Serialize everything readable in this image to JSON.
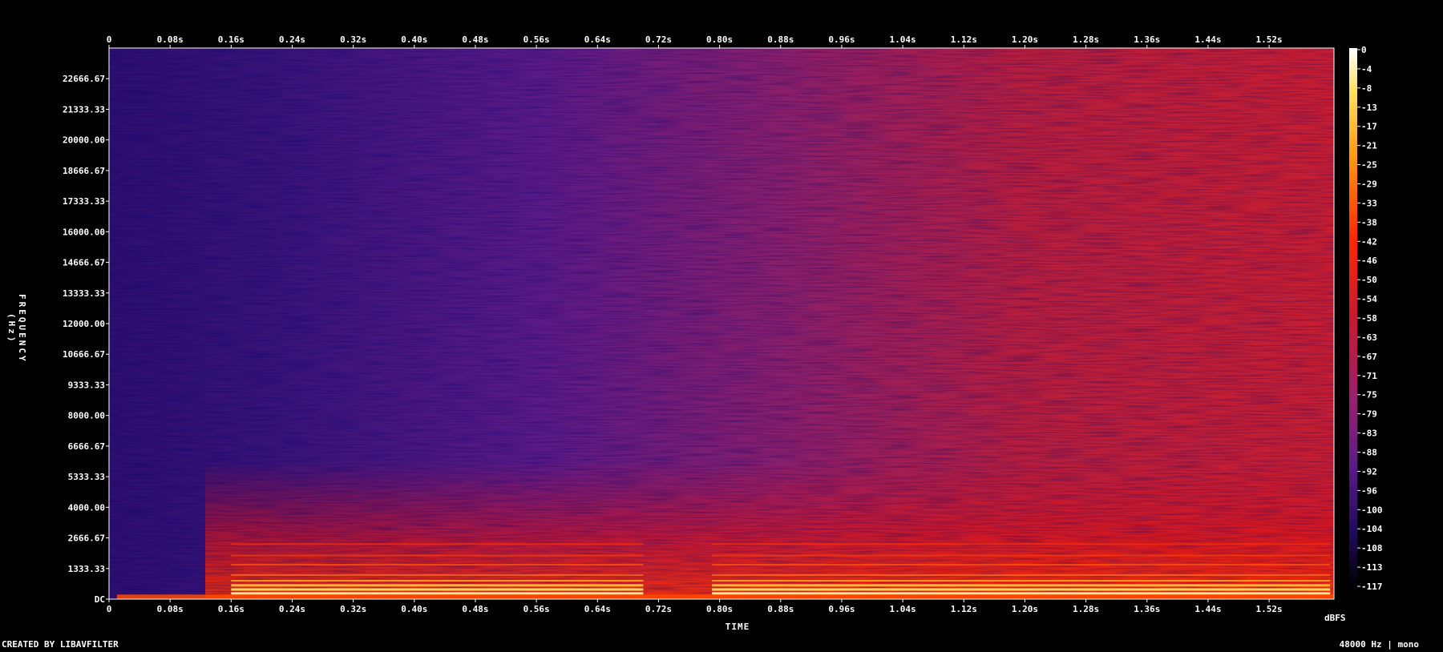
{
  "chart_data": {
    "type": "heatmap",
    "title": "",
    "xlabel": "TIME",
    "ylabel": "FREQUENCY (Hz)",
    "x_tick_labels": [
      "0",
      "0.08s",
      "0.16s",
      "0.24s",
      "0.32s",
      "0.40s",
      "0.48s",
      "0.56s",
      "0.64s",
      "0.72s",
      "0.80s",
      "0.88s",
      "0.96s",
      "1.04s",
      "1.12s",
      "1.20s",
      "1.28s",
      "1.36s",
      "1.44s",
      "1.52s"
    ],
    "x_ticks": [
      0,
      0.08,
      0.16,
      0.24,
      0.32,
      0.4,
      0.48,
      0.56,
      0.64,
      0.72,
      0.8,
      0.88,
      0.96,
      1.04,
      1.12,
      1.2,
      1.28,
      1.36,
      1.44,
      1.52
    ],
    "xlim": [
      0,
      1.605
    ],
    "y_tick_labels": [
      "DC",
      "1333.33",
      "2666.67",
      "4000.00",
      "5333.33",
      "6666.67",
      "8000.00",
      "9333.33",
      "10666.67",
      "12000.00",
      "13333.33",
      "14666.67",
      "16000.00",
      "17333.33",
      "18666.67",
      "20000.00",
      "21333.33",
      "22666.67"
    ],
    "y_ticks": [
      0,
      1333.33,
      2666.67,
      4000,
      5333.33,
      6666.67,
      8000,
      9333.33,
      10666.67,
      12000,
      13333.33,
      14666.67,
      16000,
      17333.33,
      18666.67,
      20000,
      21333.33,
      22666.67
    ],
    "ylim": [
      0,
      24000
    ],
    "colorbar": {
      "unit": "dBFS",
      "tick_labels": [
        "0",
        "-4",
        "-8",
        "-13",
        "-17",
        "-21",
        "-25",
        "-29",
        "-33",
        "-38",
        "-42",
        "-46",
        "-50",
        "-54",
        "-58",
        "-63",
        "-67",
        "-71",
        "-75",
        "-79",
        "-83",
        "-88",
        "-92",
        "-96",
        "-100",
        "-104",
        "-108",
        "-113",
        "-117"
      ],
      "range": [
        -120,
        0
      ],
      "colors": [
        "#000000",
        "#0c0530",
        "#2a0a6a",
        "#4a1a8a",
        "#7a1f90",
        "#a0206a",
        "#c4183a",
        "#e01010",
        "#ff3000",
        "#ff7000",
        "#ffb020",
        "#ffe060",
        "#ffffff"
      ]
    },
    "regions_db": {
      "background_start": -96,
      "background_end": -55,
      "low_freq_band_max": -8,
      "harmonic_bands_db": -20
    }
  },
  "footer": {
    "credit": "CREATED BY LIBAVFILTER",
    "sample_rate": "48000 Hz | mono"
  }
}
